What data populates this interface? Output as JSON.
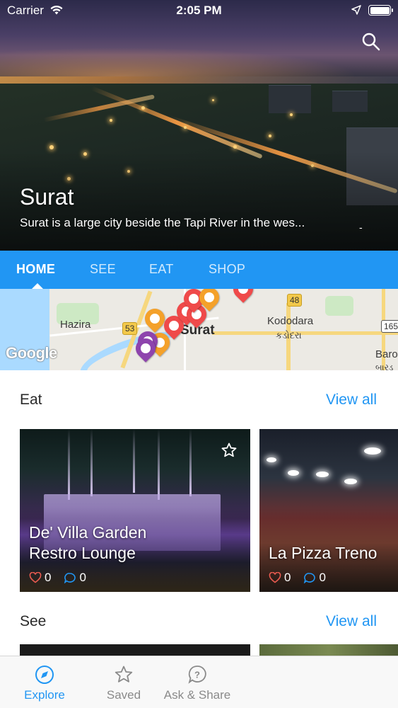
{
  "status_bar": {
    "carrier": "Carrier",
    "time": "2:05 PM"
  },
  "hero": {
    "title": "Surat",
    "description": "Surat is a large city beside the Tapi River in the wes...",
    "page_indicator": "-"
  },
  "tabs": [
    {
      "label": "HOME",
      "active": true
    },
    {
      "label": "SEE",
      "active": false
    },
    {
      "label": "EAT",
      "active": false
    },
    {
      "label": "SHOP",
      "active": false
    }
  ],
  "map": {
    "places": [
      "Hazira",
      "Surat",
      "Kododara",
      "કડોદરા",
      "Baro",
      "બારડ"
    ],
    "highway_shields": [
      "48",
      "53",
      "165"
    ],
    "logo": "Google"
  },
  "eat_section": {
    "title": "Eat",
    "view_all": "View all",
    "cards": [
      {
        "title_line1": "De' Villa Garden",
        "title_line2": "Restro Lounge",
        "likes": "0",
        "comments": "0"
      },
      {
        "title_line1": "La Pizza Treno",
        "title_line2": "",
        "likes": "0",
        "comments": "0"
      }
    ]
  },
  "see_section": {
    "title": "See",
    "view_all": "View all"
  },
  "bottom_nav": [
    {
      "label": "Explore",
      "icon": "compass-icon",
      "active": true
    },
    {
      "label": "Saved",
      "icon": "star-icon",
      "active": false
    },
    {
      "label": "Ask & Share",
      "icon": "question-bubble-icon",
      "active": false
    }
  ],
  "colors": {
    "accent": "#2196f3",
    "pin_red": "#ef4a4a",
    "pin_orange": "#f4a12a",
    "pin_purple": "#8e44ad"
  }
}
